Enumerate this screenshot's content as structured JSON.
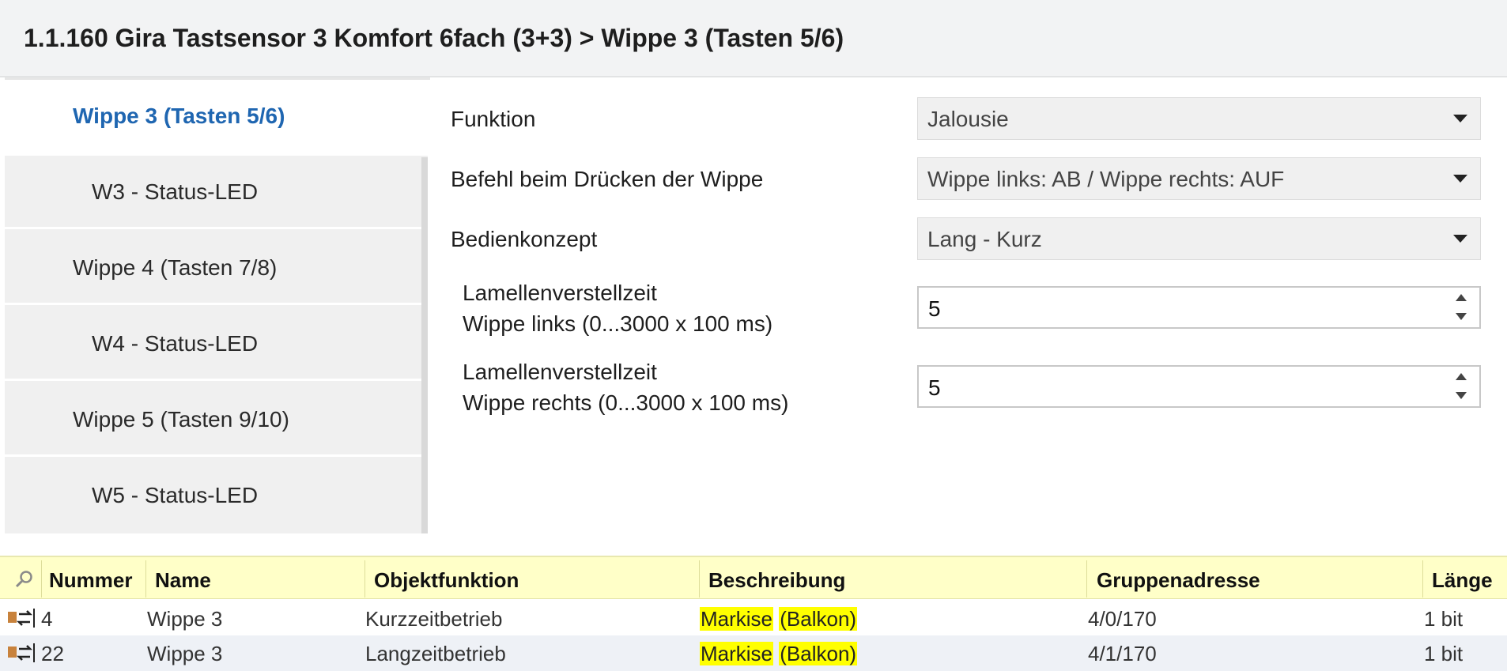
{
  "header": {
    "title": "1.1.160 Gira Tastsensor 3 Komfort 6fach (3+3) > Wippe 3 (Tasten 5/6)"
  },
  "sidebar": {
    "items": [
      {
        "label": "Wippe 3 (Tasten 5/6)",
        "active": true
      },
      {
        "label": "W3 - Status-LED"
      },
      {
        "label": "Wippe 4 (Tasten 7/8)"
      },
      {
        "label": "W4 - Status-LED"
      },
      {
        "label": "Wippe 5 (Tasten 9/10)"
      },
      {
        "label": "W5 - Status-LED"
      }
    ]
  },
  "params": {
    "funktion": {
      "label": "Funktion",
      "value": "Jalousie"
    },
    "befehl": {
      "label": "Befehl beim Drücken der Wippe",
      "value": "Wippe links: AB / Wippe rechts: AUF"
    },
    "bedienkonzept": {
      "label": "Bedienkonzept",
      "value": "Lang - Kurz"
    },
    "lamellen_links": {
      "label_line1": "Lamellenverstellzeit",
      "label_line2": "Wippe links (0...3000 x 100 ms)",
      "value": "5"
    },
    "lamellen_rechts": {
      "label_line1": "Lamellenverstellzeit",
      "label_line2": "Wippe rechts (0...3000 x 100 ms)",
      "value": "5"
    }
  },
  "table": {
    "columns": [
      "Nummer",
      "Name",
      "Objektfunktion",
      "Beschreibung",
      "Gruppenadresse",
      "Länge"
    ],
    "rows": [
      {
        "nummer": "4",
        "name": "Wippe 3",
        "objektfunktion": "Kurzzeitbetrieb",
        "beschreibung_1": "Markise",
        "beschreibung_2": "(Balkon)",
        "gruppenadresse": "4/0/170",
        "laenge": "1 bit"
      },
      {
        "nummer": "22",
        "name": "Wippe 3",
        "objektfunktion": "Langzeitbetrieb",
        "beschreibung_1": "Markise",
        "beschreibung_2": "(Balkon)",
        "gruppenadresse": "4/1/170",
        "laenge": "1 bit"
      }
    ]
  },
  "colors": {
    "accent": "#1f66b1",
    "table_header": "#ffffc8",
    "highlight": "#ffff00"
  }
}
